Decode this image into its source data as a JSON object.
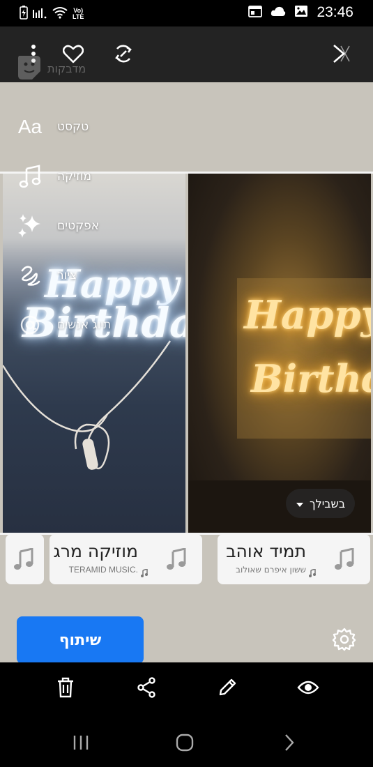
{
  "status": {
    "time": "23:46",
    "network_type_top": "Vo)",
    "network_type_bottom": "LTE"
  },
  "toolbar": {
    "sticker_label": "מדבקות"
  },
  "tools": [
    {
      "label": "טקסט",
      "icon": "text-aa-icon"
    },
    {
      "label": "מוזיקה",
      "icon": "music-note-icon"
    },
    {
      "label": "אפקטים",
      "icon": "sparkles-icon"
    },
    {
      "label": "ציור",
      "icon": "scribble-icon"
    },
    {
      "label": "תיוג אנשים",
      "icon": "at-sign-icon"
    }
  ],
  "canvas": {
    "left_neon_line1": "Happy",
    "left_neon_line2": "Birthday",
    "right_neon_line1": "Happy",
    "right_neon_line2": "Birthda"
  },
  "for_you": {
    "label": "בשבילך"
  },
  "music_suggestions": [
    {
      "title": "תמיד אוהב",
      "artist": "ששון איפרם שאולוב"
    },
    {
      "title": "מוזיקה מרג",
      "artist": "TERAMID MUSIC."
    }
  ],
  "share_button": {
    "label": "שיתוף"
  },
  "colors": {
    "accent": "#1878f3",
    "top_bar": "#232323",
    "card": "#f5f5f5"
  }
}
